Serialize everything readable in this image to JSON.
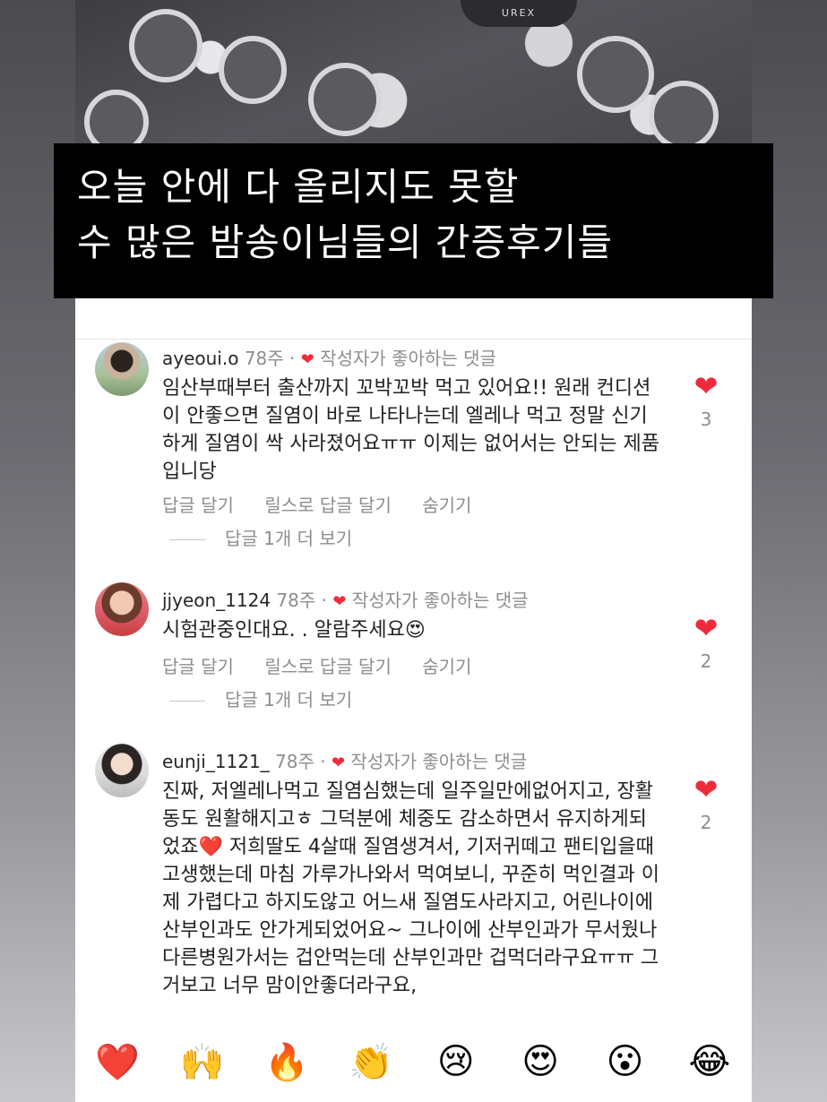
{
  "hero": {
    "product_label": "UREX"
  },
  "banner": {
    "line1": "오늘 안에 다 올리지도 못할",
    "line2": "수 많은 밤송이님들의 간증후기들"
  },
  "comments": [
    {
      "username": "ayeoui.o",
      "time": "78주",
      "sep": "·",
      "liked_by_author": "작성자가 좋아하는 댓글",
      "text": "임산부때부터 출산까지 꼬박꼬박 먹고 있어요!! 원래 컨디션이 안좋으면 질염이 바로 나타나는데 엘레나 먹고 정말 신기하게 질염이 싹 사라졌어요ㅠㅠ 이제는 없어서는 안되는 제품입니당",
      "likes": "3",
      "reply": "답글 달기",
      "reels_reply": "릴스로 답글 달기",
      "hide": "숨기기",
      "more_replies": "답글 1개 더 보기"
    },
    {
      "username": "jjyeon_1124",
      "time": "78주",
      "sep": "·",
      "liked_by_author": "작성자가 좋아하는 댓글",
      "text": "시험관중인대요. . 알람주세요😍",
      "likes": "2",
      "reply": "답글 달기",
      "reels_reply": "릴스로 답글 달기",
      "hide": "숨기기",
      "more_replies": "답글 1개 더 보기"
    },
    {
      "username": "eunji_1121_",
      "time": "78주",
      "sep": "·",
      "liked_by_author": "작성자가 좋아하는 댓글",
      "text": "진짜, 저엘레나먹고 질염심했는데 일주일만에없어지고, 장활동도 원활해지고ㅎ 그덕분에 체중도 감소하면서 유지하게되었죠❤️ 저희딸도 4살때 질염생겨서, 기저귀떼고 팬티입을때 고생했는데 마침 가루가나와서 먹여보니, 꾸준히 먹인결과 이제 가렵다고 하지도않고 어느새 질염도사라지고, 어린나이에 산부인과도 안가게되었어요~ 그나이에 산부인과가 무서웠나 다른병원가서는 겁안먹는데 산부인과만 겁먹더라구요ㅠㅠ 그거보고 너무 맘이안좋더라구요,",
      "likes": "2"
    }
  ],
  "reactions": [
    "❤️",
    "🙌",
    "🔥",
    "👏",
    "😢",
    "😍",
    "😮",
    "😂"
  ],
  "colors": {
    "heart": "#ed2b3c",
    "muted": "#8e8e8e",
    "text": "#222222"
  }
}
